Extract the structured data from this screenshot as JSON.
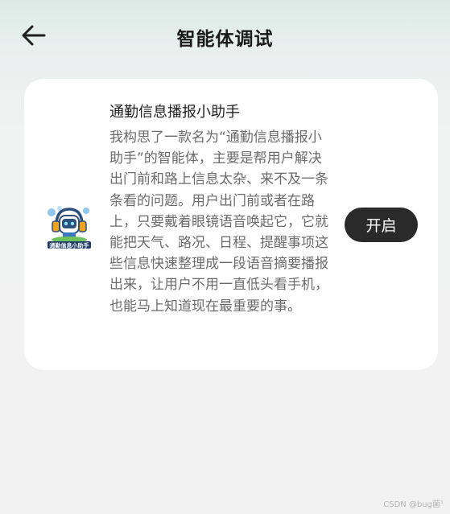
{
  "header": {
    "title": "智能体调试",
    "back_icon": "arrow-left-icon"
  },
  "agent": {
    "logo_icon": "agent-headphones-robot-logo",
    "logo_text": "通勤信息小助手",
    "name": "通勤信息播报小助手",
    "description": "我构思了一款名为“通勤信息播报小助手”的智能体，主要是帮用户解决出门前和路上信息太杂、来不及一条条看的问题。用户出门前或者在路上，只要戴着眼镜语音唤起它，它就能把天气、路况、日程、提醒事项这些信息快速整理成一段语音摘要播报出来，让用户不用一直低头看手机，也能马上知道现在最重要的事。",
    "start_label": "开启"
  },
  "watermark": "CSDN @bug菌¹",
  "colors": {
    "button_bg": "#2a2a2a",
    "card_bg": "#ffffff",
    "page_bg": "#f2f2f3"
  }
}
